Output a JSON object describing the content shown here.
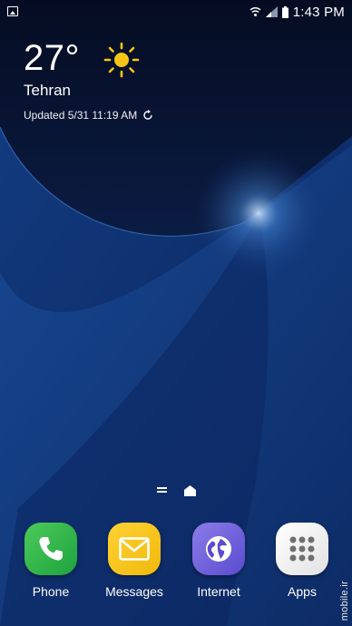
{
  "status_bar": {
    "time": "1:43 PM",
    "icons": [
      "gallery-notification-icon",
      "wifi-icon",
      "signal-icon",
      "battery-icon"
    ]
  },
  "weather": {
    "temperature": "27°",
    "city": "Tehran",
    "updated": "Updated 5/31 11:19 AM",
    "condition_icon": "sun-icon",
    "sun_color": "#f5c518"
  },
  "dock": {
    "apps": [
      {
        "label": "Phone",
        "icon": "phone-icon",
        "color": "#2bb24c"
      },
      {
        "label": "Messages",
        "icon": "envelope-icon",
        "color": "#f7c415"
      },
      {
        "label": "Internet",
        "icon": "globe-icon",
        "color": "#6a5ed8"
      },
      {
        "label": "Apps",
        "icon": "grid-icon",
        "color": "#eeeeee"
      }
    ]
  },
  "watermark": "mobile.ir"
}
